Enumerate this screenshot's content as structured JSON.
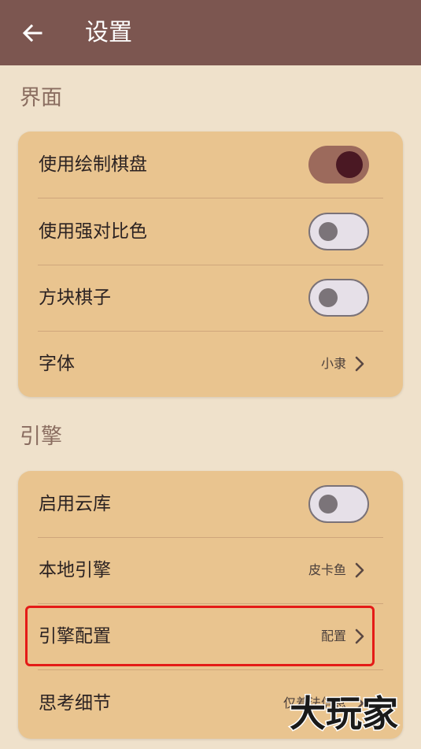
{
  "appbar": {
    "title": "设置",
    "back_icon": "arrow-left-icon"
  },
  "sections": {
    "ui": {
      "title": "界面",
      "items": [
        {
          "label": "使用绘制棋盘",
          "toggle": true
        },
        {
          "label": "使用强对比色",
          "toggle": false
        },
        {
          "label": "方块棋子",
          "toggle": false
        },
        {
          "label": "字体",
          "value": "小隶"
        }
      ]
    },
    "engine": {
      "title": "引擎",
      "items": [
        {
          "label": "启用云库",
          "toggle": false
        },
        {
          "label": "本地引擎",
          "value": "皮卡鱼"
        },
        {
          "label": "引擎配置",
          "value": "配置"
        },
        {
          "label": "思考细节",
          "value": "仅着法信息"
        }
      ]
    }
  },
  "watermark": {
    "text": "大玩家"
  },
  "colors": {
    "appbar": "#7c5650",
    "background": "#efe1cb",
    "card": "#e9c48f",
    "switch_on_track": "#9c6a5c",
    "switch_on_knob": "#4a1823",
    "highlight": "#e41b17"
  }
}
